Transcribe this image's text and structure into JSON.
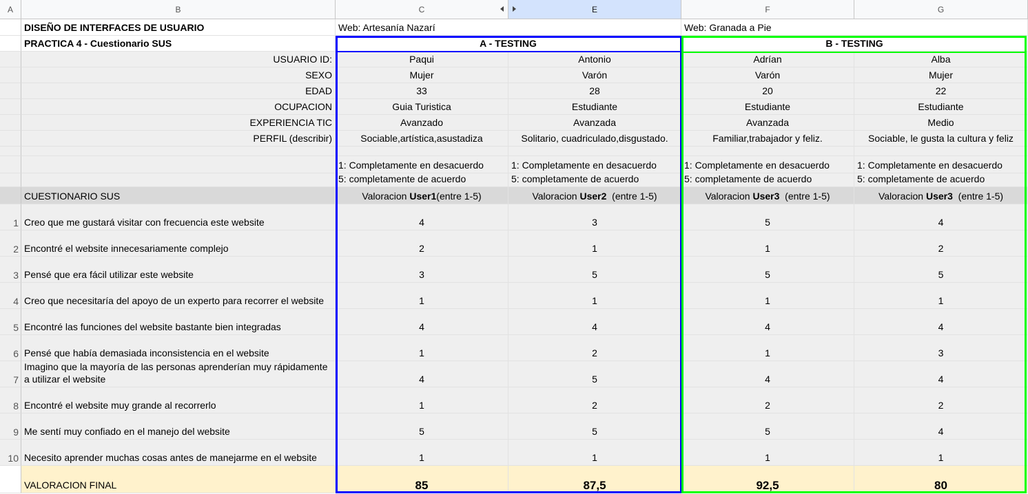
{
  "columns": [
    "A",
    "B",
    "C",
    "E",
    "F",
    "G"
  ],
  "title1": "DISEÑO DE INTERFACES DE USUARIO",
  "title2": "PRACTICA 4 - Cuestionario SUS",
  "web_a": "Web: Artesanía Nazarí",
  "web_b": "Web: Granada a Pie",
  "testing_a": "A -  TESTING",
  "testing_b": "B  -  TESTING",
  "profile_labels": {
    "id": "USUARIO ID:",
    "sexo": "SEXO",
    "edad": "EDAD",
    "ocupacion": "OCUPACION",
    "experiencia": "EXPERIENCIA TIC",
    "perfil": "PERFIL (describir)"
  },
  "users": [
    {
      "id": "Paqui",
      "sexo": "Mujer",
      "edad": "33",
      "ocupacion": "Guia Turistica",
      "experiencia": "Avanzado",
      "perfil": "Sociable,artística,asustadiza",
      "val_pre": "Valoracion ",
      "val_user": "User1",
      "val_post": "(entre 1-5)",
      "final": "85"
    },
    {
      "id": "Antonio",
      "sexo": "Varón",
      "edad": "28",
      "ocupacion": "Estudiante",
      "experiencia": "Avanzada",
      "perfil": "Solitario, cuadriculado,disgustado.",
      "val_pre": "Valoracion ",
      "val_user": "User2",
      "val_post": "  (entre 1-5)",
      "final": "87,5"
    },
    {
      "id": "Adrían",
      "sexo": "Varón",
      "edad": "20",
      "ocupacion": "Estudiante",
      "experiencia": "Avanzada",
      "perfil": "Familiar,trabajador y feliz.",
      "val_pre": "Valoracion ",
      "val_user": "User3",
      "val_post": "  (entre 1-5)",
      "final": "92,5"
    },
    {
      "id": "Alba",
      "sexo": "Mujer",
      "edad": "22",
      "ocupacion": "Estudiante",
      "experiencia": "Medio",
      "perfil": "Sociable, le gusta la cultura y feliz",
      "val_pre": "Valoracion ",
      "val_user": "User3",
      "val_post": "  (entre 1-5)",
      "final": "80"
    }
  ],
  "scale_1": "1: Completamente en desacuerdo",
  "scale_5": "5: completamente de acuerdo",
  "sus_header": "CUESTIONARIO SUS",
  "questions": [
    {
      "n": "1",
      "text": "Creo que me gustará visitar con frecuencia este website",
      "scores": [
        "4",
        "3",
        "5",
        "4"
      ]
    },
    {
      "n": "2",
      "text": "Encontré el website innecesariamente complejo",
      "scores": [
        "2",
        "1",
        "1",
        "2"
      ]
    },
    {
      "n": "3",
      "text": "Pensé que era fácil utilizar este website",
      "scores": [
        "3",
        "5",
        "5",
        "5"
      ]
    },
    {
      "n": "4",
      "text": "Creo que necesitaría del apoyo de un experto para recorrer el website",
      "scores": [
        "1",
        "1",
        "1",
        "1"
      ]
    },
    {
      "n": "5",
      "text": "Encontré las funciones del website bastante bien integradas",
      "scores": [
        "4",
        "4",
        "4",
        "4"
      ]
    },
    {
      "n": "6",
      "text": "Pensé que había demasiada inconsistencia en el website",
      "scores": [
        "1",
        "2",
        "1",
        "3"
      ]
    },
    {
      "n": "7",
      "text": "Imagino que la mayoría de las personas aprenderían muy rápidamente a utilizar el website",
      "scores": [
        "4",
        "5",
        "4",
        "4"
      ]
    },
    {
      "n": "8",
      "text": "Encontré el website muy grande al recorrerlo",
      "scores": [
        "1",
        "2",
        "2",
        "2"
      ]
    },
    {
      "n": "9",
      "text": "Me sentí muy confiado en el manejo del website",
      "scores": [
        "5",
        "5",
        "5",
        "4"
      ]
    },
    {
      "n": "10",
      "text": "Necesito aprender muchas cosas antes de manejarme en el website",
      "scores": [
        "1",
        "1",
        "1",
        "1"
      ]
    }
  ],
  "final_label": "VALORACION FINAL"
}
